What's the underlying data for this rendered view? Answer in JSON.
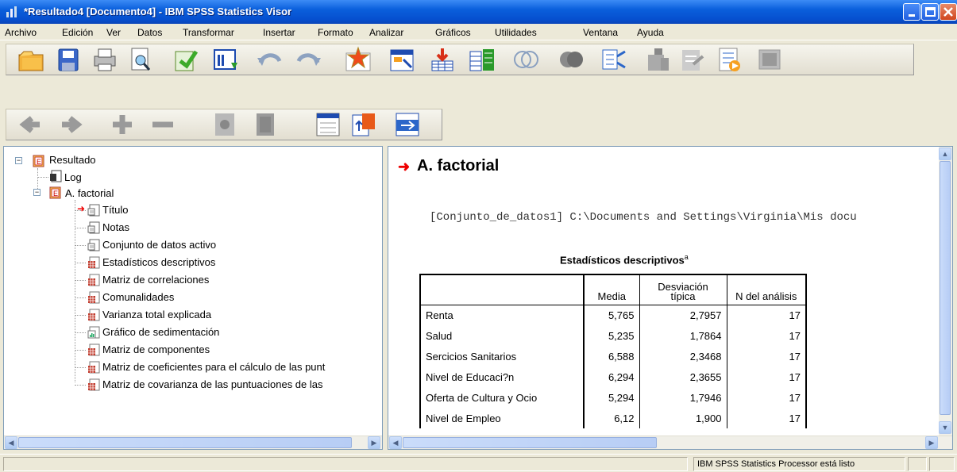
{
  "window": {
    "title": "*Resultado4 [Documento4] - IBM SPSS Statistics Visor"
  },
  "menu": [
    "Archivo",
    "Edición",
    "Ver",
    "Datos",
    "Transformar",
    "Insertar",
    "Formato",
    "Analizar",
    "Gráficos",
    "Utilidades",
    "Ventana",
    "Ayuda"
  ],
  "tree": {
    "root": "Resultado",
    "log": "Log",
    "analysis": "A. factorial",
    "items": [
      "Título",
      "Notas",
      "Conjunto de datos activo",
      "Estadísticos descriptivos",
      "Matriz de correlaciones",
      "Comunalidades",
      "Varianza total explicada",
      "Gráfico de sedimentación",
      "Matriz de componentes",
      "Matriz de coeficientes para el cálculo de las punt",
      "Matriz de covarianza de las puntuaciones de las"
    ]
  },
  "output": {
    "heading": "A. factorial",
    "dataset_line": "[Conjunto_de_datos1] C:\\Documents and Settings\\Virginia\\Mis docu",
    "table_title": "Estadísticos descriptivos",
    "table_title_sup": "a",
    "columns": [
      "Media",
      "Desviación típica",
      "N del análisis"
    ],
    "rows": [
      [
        "Renta",
        "5,765",
        "2,7957",
        "17"
      ],
      [
        "Salud",
        "5,235",
        "1,7864",
        "17"
      ],
      [
        "Sercicios Sanitarios",
        "6,588",
        "2,3468",
        "17"
      ],
      [
        "Nivel de Educaci?n",
        "6,294",
        "2,3655",
        "17"
      ],
      [
        "Oferta de Cultura y Ocio",
        "5,294",
        "1,7946",
        "17"
      ],
      [
        "Nivel de Empleo",
        "6,12",
        "1,900",
        "17"
      ]
    ]
  },
  "status": {
    "message": "IBM SPSS Statistics Processor está listo"
  },
  "icons": {
    "toolbar1": [
      "open-folder-icon",
      "save-icon",
      "print-icon",
      "print-preview-icon",
      "export-icon",
      "recall-dialog-icon",
      "undo-icon",
      "redo-icon",
      "goto-data-icon",
      "goto-case-icon",
      "goto-variable-icon",
      "variables-icon",
      "use-sets-icon",
      "show-all-variables-icon",
      "spelling-icon",
      "create-edit-autoscript-icon",
      "run-script-icon",
      "designate-window-icon",
      "select-last-output-icon"
    ],
    "toolbar2": [
      "promote-icon",
      "demote-icon",
      "expand-icon",
      "collapse-icon",
      "show-icon",
      "hide-icon",
      "insert-heading-icon",
      "insert-title-icon",
      "insert-text-icon"
    ]
  }
}
